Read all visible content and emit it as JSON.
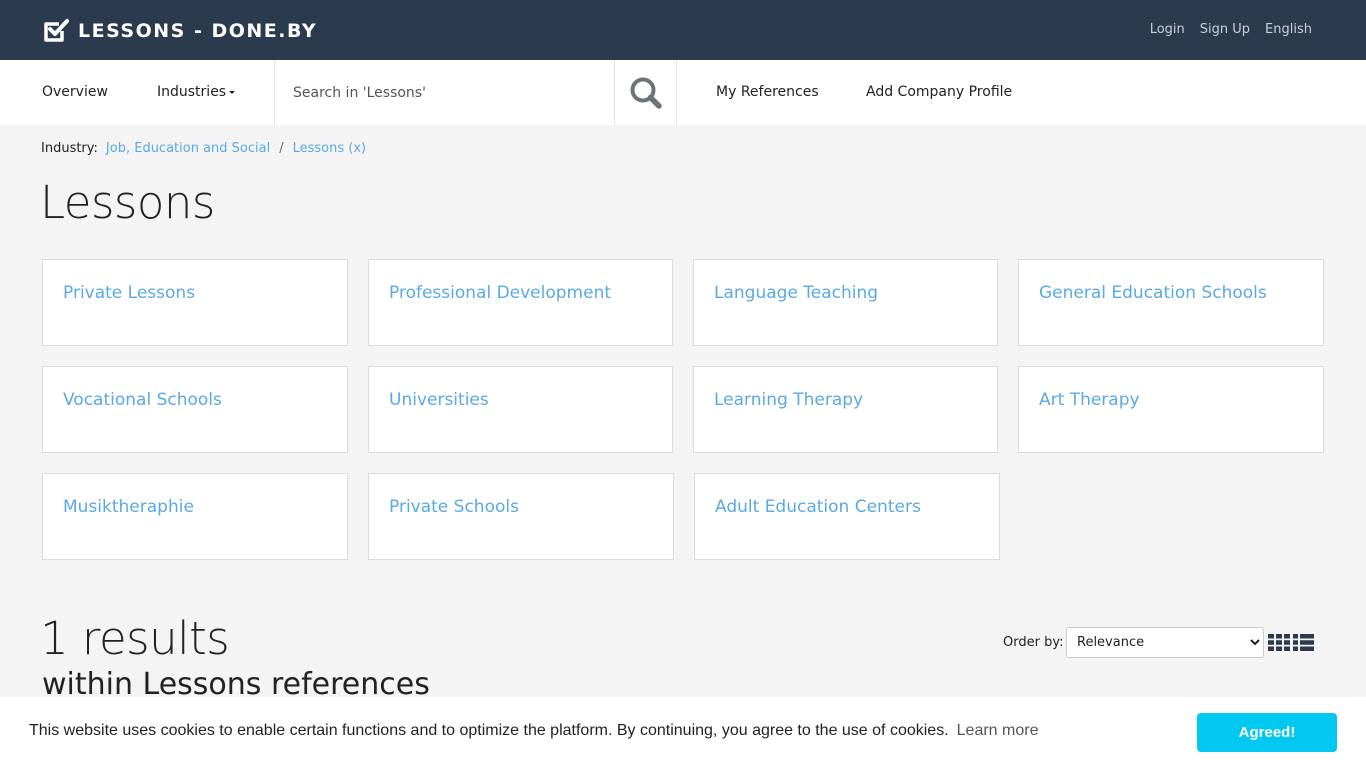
{
  "header": {
    "logo_text": "LESSONS - DONE.BY",
    "links": [
      "Login",
      "Sign Up",
      "English"
    ]
  },
  "nav": {
    "overview": "Overview",
    "industries": "Industries",
    "search_placeholder": "Search in 'Lessons'",
    "my_references": "My References",
    "add_company_profile": "Add Company Profile"
  },
  "breadcrumb": {
    "label": "Industry:",
    "items": [
      "Job, Education and Social",
      "Lessons (x)"
    ],
    "separator": "/"
  },
  "page": {
    "title": "Lessons"
  },
  "categories": [
    "Private Lessons",
    "Professional Development",
    "Language Teaching",
    "General Education Schools",
    "Vocational Schools",
    "Universities",
    "Learning Therapy",
    "Art Therapy",
    "Musiktheraphie",
    "Private Schools",
    "Adult Education Centers"
  ],
  "results": {
    "count": "1 results",
    "subtitle": "within Lessons references",
    "order_label": "Order by:",
    "order_selected": "Relevance"
  },
  "cookie": {
    "text": "This website uses cookies to enable certain functions and to optimize the platform. By continuing, you agree to the use of cookies.",
    "learn_more": "Learn more",
    "button": "Agreed!"
  },
  "colors": {
    "header_bg": "#2c3a4e",
    "link": "#5aa9e6",
    "accept_button": "#00c8f0"
  },
  "icons": [
    "check-square-icon",
    "caret-down-icon",
    "search-icon",
    "grid-view-icon",
    "list-view-icon"
  ]
}
